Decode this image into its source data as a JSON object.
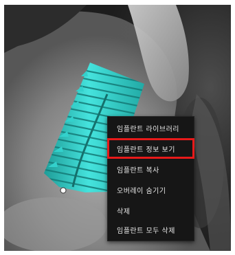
{
  "context_menu": {
    "items": [
      {
        "label": "임플란트 라이브러리"
      },
      {
        "label": "임플란트 정보 보기",
        "highlighted": true
      },
      {
        "label": "임플란트 복사"
      },
      {
        "label": "오버레이 숨기기"
      },
      {
        "label": "삭제"
      },
      {
        "label": "임플란트 모두 삭제"
      }
    ]
  },
  "colors": {
    "implant": "#33d1cc",
    "implant_dark": "#1b8f8b",
    "highlight_border": "#e81a1a",
    "menu_bg": "#161616"
  }
}
